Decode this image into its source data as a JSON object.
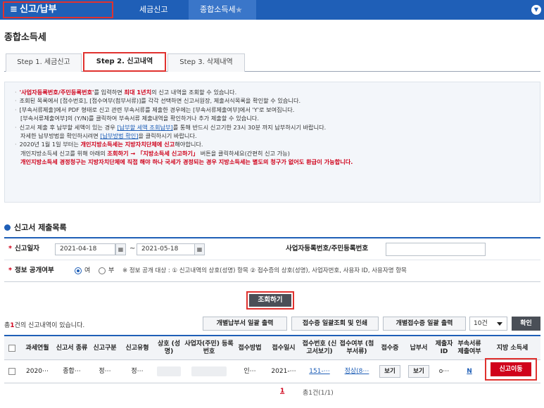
{
  "nav": {
    "home": "신고/납부",
    "crumb1": "세금신고",
    "crumb2": "종합소득세"
  },
  "page_title": "종합소득세",
  "tabs": [
    {
      "label": "Step 1. 세금신고"
    },
    {
      "label": "Step 2. 신고내역"
    },
    {
      "label": "Step 3. 삭제내역"
    }
  ],
  "notice": {
    "l1a": "'사업자등록번호/주민등록번호'",
    "l1b": "를 입력하면 ",
    "l1c": "최대 1년치",
    "l1d": "의 신고 내역을 조회할 수 있습니다.",
    "l2": "조회된 목록에서 [접수번호], [접수여부(첨부서류)]를 각각 선택하면 신고서원장, 제출서식목록을 확인할 수 있습니다.",
    "l3": "[부속서류제출]에서 PDF 형태로 신고 관련 부속서류를 제출한 경우에는 [부속서류제출여부]에서 'Y'로 보여집니다.",
    "l4": "[부속서류제출여부]의 (Y/N)를 클릭하여 부속서류 제출내역을 확인하거나 추가 제출할 수 있습니다.",
    "l5a": "신고서 제출 후 납부할 세액이 있는 경우 ",
    "l5b": "[납부할 세액 조회납부]",
    "l5c": "를 통해 반드시 신고기한 23시 30분 까지 납부하시기 바랍니다.",
    "l6a": "자세한 납부방법을 확인하시려면 ",
    "l6b": "[납부방법 확인]",
    "l6c": "을 클릭하시기 바랍니다.",
    "l7a": "2020년 1월 1일 부터는 ",
    "l7b": "개인지방소득세는 지방자치단체에 신고",
    "l7c": "해야합니다.",
    "l8a": "개인지방소득세 신고를 위해 아래의 ",
    "l8b": "조회하기 → 「지방소득세 신고하기」",
    "l8c": " 버튼을 클릭하세요(간편히 신고 가능)",
    "l9": "개인지방소득세 경정청구는 지방자치단체에 직접 해야 하나 국세가 경정되는 경우 지방소득세는 별도의 청구가 없어도 환급이 가능합니다."
  },
  "section_title": "신고서 제출목록",
  "form": {
    "date_label": "신고일자",
    "date_from": "2021-04-18",
    "date_to": "2021-05-18",
    "tilde": "~",
    "biz_label": "사업자등록번호/주민등록번호",
    "public_label": "정보 공개여부",
    "opt_yes": "여",
    "opt_no": "부",
    "public_note": "※ 정보 공개 대상 : ① 신고내역의 상호(성명) 항목 ② 접수증의 상호(성명), 사업자번호, 사용자 ID, 사용자명 항목"
  },
  "search_button": "조회하기",
  "toolbar": {
    "count_prefix": "총",
    "count": "1",
    "count_suffix": "건의 신고내역이 있습니다.",
    "btn1": "개별납부서 일괄 출력",
    "btn2": "접수증 일괄조회 및 인쇄",
    "btn3": "개별접수증 일괄 출력",
    "page_size": "10건",
    "confirm": "확인"
  },
  "table": {
    "headers": [
      "과세연월",
      "신고서 종류",
      "신고구분",
      "신고유형",
      "상호 (성명)",
      "사업자(주민) 등록번호",
      "접수방법",
      "접수일시",
      "접수번호 (신고서보기)",
      "접수여부 (첨부서류)",
      "접수증",
      "납부서",
      "제출자 ID",
      "부속서류 제출여부",
      "지방 소득세"
    ],
    "row": {
      "period": "2020⋯",
      "type": "종합⋯",
      "div": "정⋯",
      "kind": "정⋯",
      "method": "인⋯",
      "date": "2021-⋯",
      "receipt_no": "151-⋯",
      "status": "정상(8⋯",
      "view1": "보기",
      "view2": "보기",
      "submitter": "o⋯",
      "attach": "N",
      "local_tax": "신고이동"
    }
  },
  "pager": {
    "page": "1",
    "total": "총1건(1/1)"
  }
}
